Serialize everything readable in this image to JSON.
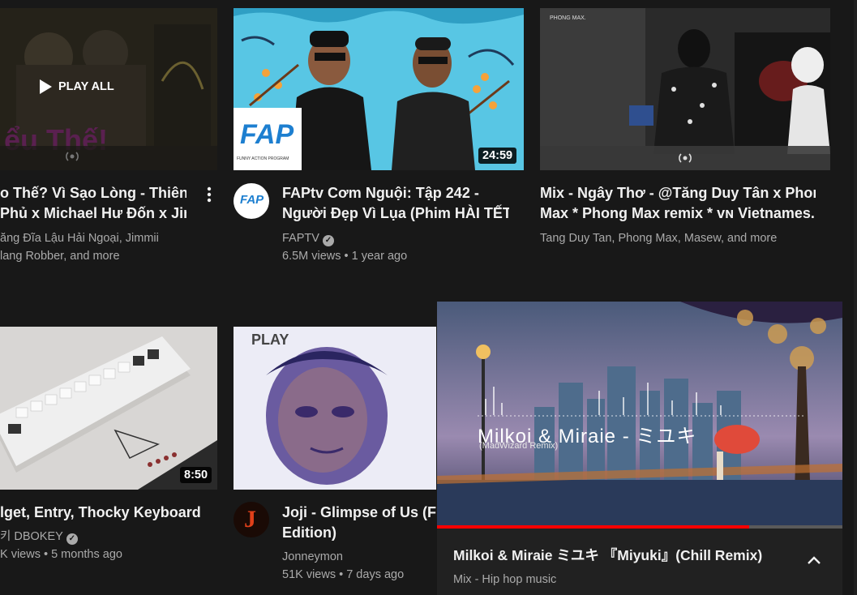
{
  "videos": [
    {
      "play_all": "PLAY ALL",
      "title_line1": "o Thế? Vì Sạo Lòng - Thiên",
      "title_line2": "Phủ x Michael Hư Đốn x Jim...",
      "meta_line1": "ăng Đĩa Lậu Hải Ngoại, Jimmii",
      "meta_line2": "lang Robber, and more"
    },
    {
      "duration": "24:59",
      "title_line1": "FAPtv Cơm Nguội: Tập 242 -",
      "title_line2": "Người Đẹp Vì Lụa (Phim HÀI TẾT...",
      "channel": "FAPTV",
      "stats": "6.5M views • 1 year ago",
      "thumb_logo": "FAP",
      "thumb_logo_sub": "FUNNY ACTION PROGRAM"
    },
    {
      "title_line1": "Mix - Ngây Thơ - @Tăng Duy Tân x Phong",
      "title_line2": "Max * Phong Max remix * ᴠɴ Vietnames...",
      "meta_line1": "Tang Duy Tan, Phong Max, Masew, and more",
      "thumb_tag": "PHONG MAX."
    },
    {
      "duration": "8:50",
      "title_line1": "lget, Entry, Thocky Keyboard",
      "channel": "키 DBOKEY",
      "stats": "K views • 5 months ago"
    },
    {
      "thumb_tag": "PLAY",
      "title_line1": "Joji - Glimpse of Us (Filt",
      "title_line2": "Edition)",
      "channel": "Jonneymon",
      "stats": "51K views • 7 days ago"
    }
  ],
  "miniplayer": {
    "art_title": "Milkoi & Miraie - ミユキ",
    "art_sub": "(MadWizard Remix)",
    "title": "Milkoi & Miraie ミユキ 『Miyuki』(Chill Remix)",
    "subtitle": "Mix - Hip hop music",
    "progress": 0.77
  }
}
